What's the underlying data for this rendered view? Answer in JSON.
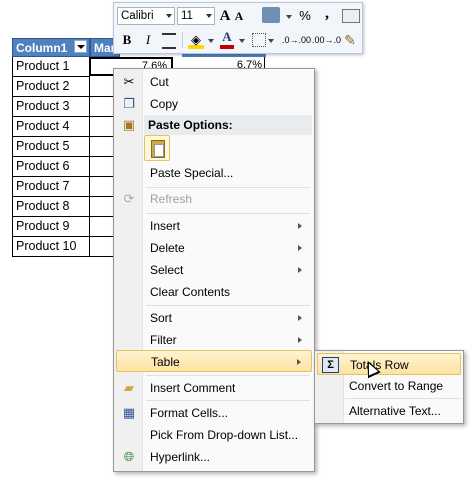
{
  "sheet": {
    "header_col1": "Column1",
    "header_col2": "Mar",
    "rows": [
      "Product 1",
      "Product 2",
      "Product 3",
      "Product 4",
      "Product 5",
      "Product 6",
      "Product 7",
      "Product 8",
      "Product 9",
      "Product 10"
    ],
    "cell_b2": "7.6%",
    "cell_c2": "6.7%"
  },
  "mini_toolbar": {
    "font_name": "Calibri",
    "font_size": "11",
    "grow_font": "A",
    "shrink_font": "A",
    "percent": "%",
    "comma": ",",
    "bold": "B",
    "italic": "I",
    "font_color": "A",
    "inc_decimal": ".0→.00",
    "dec_decimal": ".00→.0",
    "accent": "#c00000"
  },
  "menu": {
    "items": [
      {
        "label": "Cut",
        "icon": "scissors-icon"
      },
      {
        "label": "Copy",
        "icon": "copy-icon"
      },
      {
        "label": "Paste Options:",
        "icon": "paste-icon"
      },
      {
        "label": "Paste Special...",
        "icon": ""
      },
      {
        "label": "Refresh",
        "icon": "refresh-icon",
        "disabled": true
      },
      {
        "label": "Insert",
        "submenu": true
      },
      {
        "label": "Delete",
        "submenu": true
      },
      {
        "label": "Select",
        "submenu": true
      },
      {
        "label": "Clear Contents"
      },
      {
        "label": "Sort",
        "submenu": true
      },
      {
        "label": "Filter",
        "submenu": true
      },
      {
        "label": "Table",
        "submenu": true,
        "highlighted": true
      },
      {
        "label": "Insert Comment",
        "icon": "comment-icon"
      },
      {
        "label": "Format Cells...",
        "icon": "format-cells-icon"
      },
      {
        "label": "Pick From Drop-down List..."
      },
      {
        "label": "Hyperlink...",
        "icon": "hyperlink-icon"
      }
    ]
  },
  "submenu": {
    "items": [
      {
        "label": "Totals Row",
        "icon": "sigma-icon",
        "highlighted": true
      },
      {
        "label": "Convert to Range"
      },
      {
        "label": "Alternative Text..."
      }
    ]
  }
}
